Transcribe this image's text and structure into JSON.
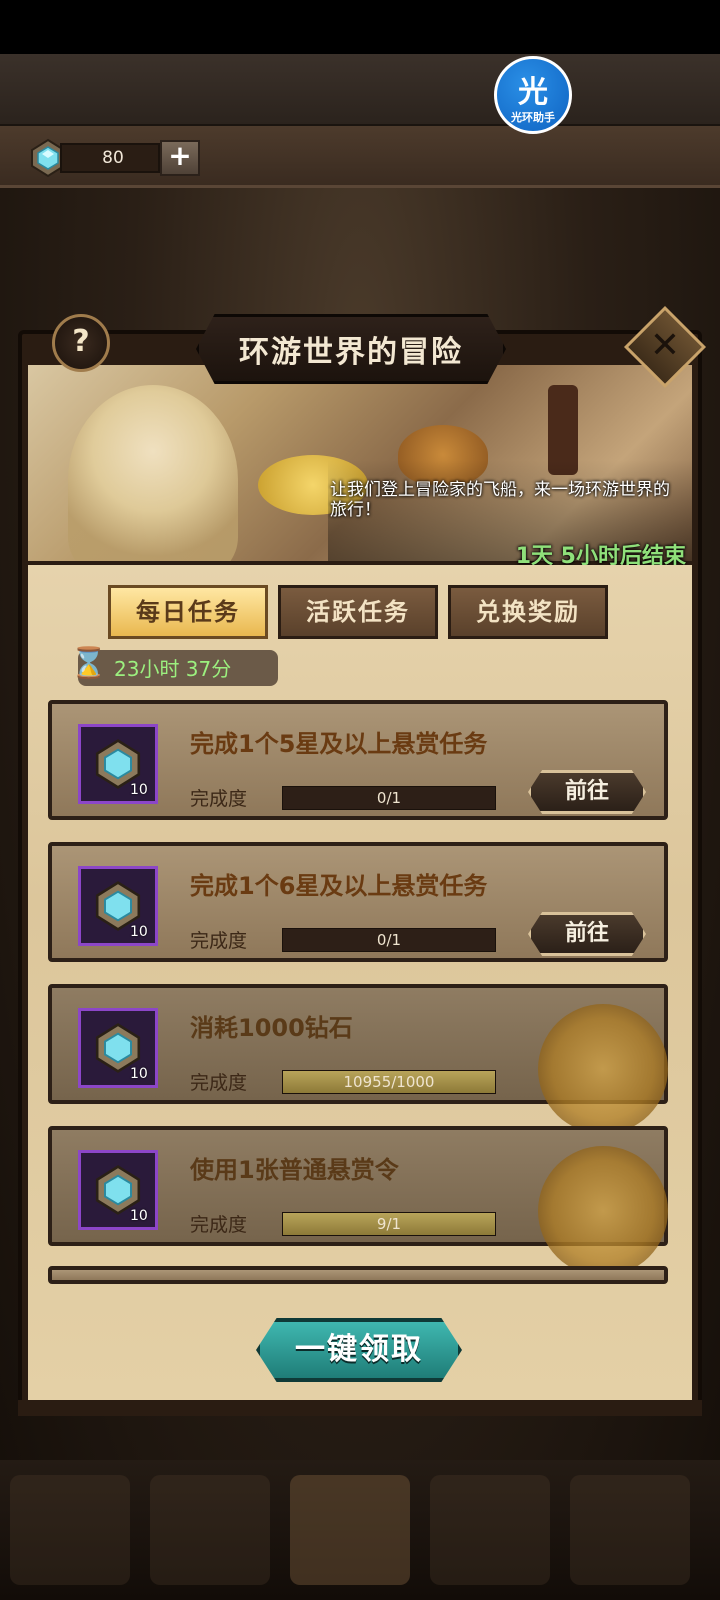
{
  "resource": {
    "amount": "80",
    "plus_glyph": "+"
  },
  "helper_badge": {
    "glyph": "光",
    "label": "光环助手"
  },
  "event": {
    "title": "环游世界的冒险",
    "description": "让我们登上冒险家的飞船，来一场环游世界的旅行！",
    "ends_in": "1天 5小时后结束"
  },
  "help_glyph": "?",
  "close_glyph": "✕",
  "tabs": [
    {
      "label": "每日任务",
      "active": true
    },
    {
      "label": "活跃任务",
      "active": false
    },
    {
      "label": "兑换奖励",
      "active": false
    }
  ],
  "daily_timer": "23小时 37分",
  "hourglass_glyph": "⌛",
  "progress_label": "完成度",
  "tasks": [
    {
      "title": "完成1个5星及以上悬赏任务",
      "progress": "0/1",
      "progress_fraction": 0,
      "reward_qty": "10",
      "action": "前往",
      "claimed": false
    },
    {
      "title": "完成1个6星及以上悬赏任务",
      "progress": "0/1",
      "progress_fraction": 0,
      "reward_qty": "10",
      "action": "前往",
      "claimed": false
    },
    {
      "title": "消耗1000钻石",
      "progress": "10955/1000",
      "progress_fraction": 1,
      "reward_qty": "10",
      "action": "",
      "claimed": true
    },
    {
      "title": "使用1张普通悬赏令",
      "progress": "9/1",
      "progress_fraction": 1,
      "reward_qty": "10",
      "action": "",
      "claimed": true
    }
  ],
  "claim_all_label": "一键领取",
  "colors": {
    "accent_teal": "#2a9a93",
    "gold": "#e9b84f",
    "reward_purple": "#8c46c8",
    "timer_green": "#8fe07a"
  }
}
